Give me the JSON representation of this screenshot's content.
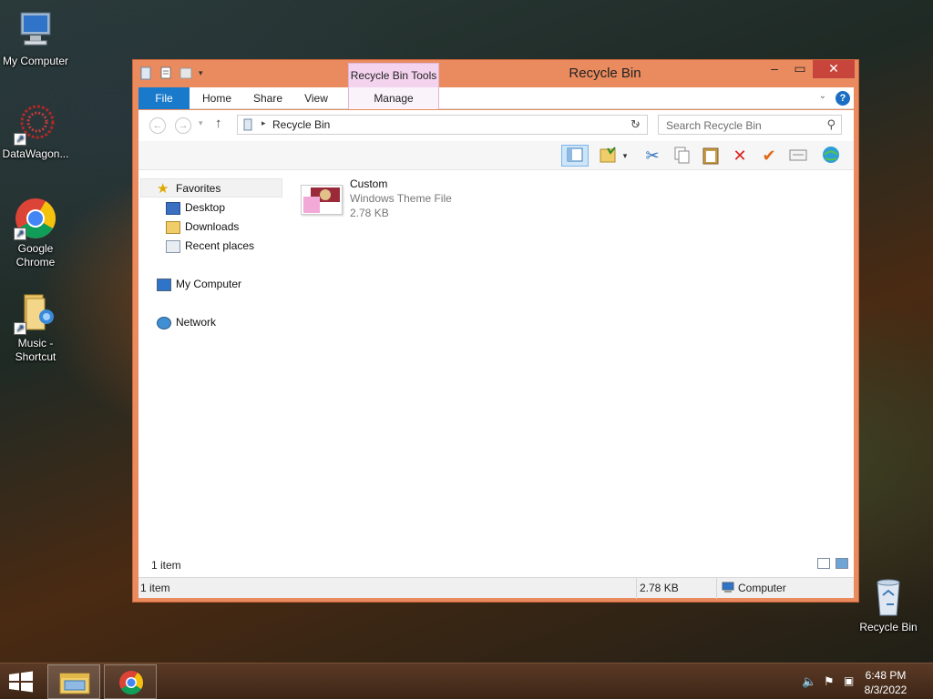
{
  "desktop": {
    "icons": [
      {
        "label": "My Computer",
        "icon": "computer-icon"
      },
      {
        "label": "DataWagon...",
        "icon": "datawagon-icon"
      },
      {
        "label": "Google Chrome",
        "icon": "chrome-icon"
      },
      {
        "label": "Music - Shortcut",
        "icon": "folder-music-icon"
      },
      {
        "label": "Recycle Bin",
        "icon": "recycle-bin-icon"
      }
    ]
  },
  "window": {
    "title": "Recycle Bin",
    "context_tab": "Recycle Bin Tools",
    "ribbon_tabs": {
      "file": "File",
      "home": "Home",
      "share": "Share",
      "view": "View",
      "manage": "Manage"
    },
    "address": {
      "path": "Recycle Bin"
    },
    "search": {
      "placeholder": "Search Recycle Bin"
    },
    "nav": {
      "favorites": "Favorites",
      "desktop": "Desktop",
      "downloads": "Downloads",
      "recent": "Recent places",
      "computer": "My Computer",
      "network": "Network"
    },
    "files": [
      {
        "name": "Custom",
        "type": "Windows Theme File",
        "size": "2.78 KB"
      }
    ],
    "item_count": "1 item",
    "status": {
      "items": "1 item",
      "size": "2.78 KB",
      "location": "Computer"
    }
  },
  "taskbar": {
    "time": "6:48 PM",
    "date": "8/3/2022"
  },
  "colors": {
    "window_frame": "#e98b5e",
    "file_tab": "#1979ca",
    "context_tab": "#f3d3ee",
    "close_button": "#c7453b"
  }
}
